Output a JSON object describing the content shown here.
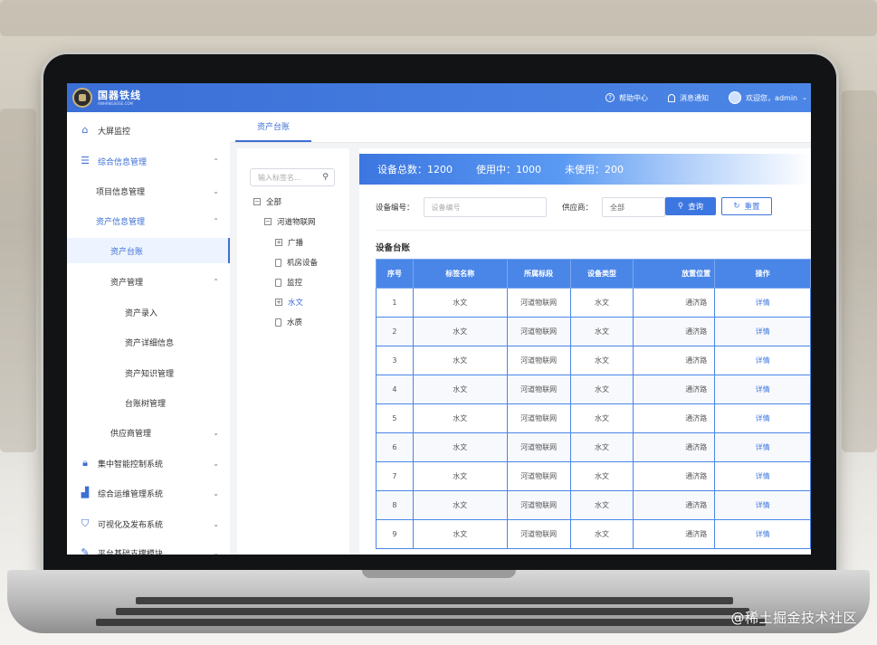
{
  "app": {
    "logo_title": "国器铁线",
    "logo_subtitle": "ANHANGSOSE.COM"
  },
  "topbar": {
    "help_label": "帮助中心",
    "notice_label": "消息通知",
    "user_label": "欢迎您，admin"
  },
  "sidebar": {
    "items": [
      {
        "label": "大屏监控",
        "icon": "home-icon"
      },
      {
        "label": "综合信息管理",
        "icon": "list-icon"
      },
      {
        "label": "项目信息管理"
      },
      {
        "label": "资产信息管理"
      },
      {
        "label": "资产台账"
      },
      {
        "label": "资产管理"
      },
      {
        "label": "资产录入"
      },
      {
        "label": "资产详细信息"
      },
      {
        "label": "资产知识管理"
      },
      {
        "label": "台账树管理"
      },
      {
        "label": "供应商管理"
      },
      {
        "label": "集中智能控制系统",
        "icon": "lock-icon"
      },
      {
        "label": "综合运维管理系统",
        "icon": "chart-icon"
      },
      {
        "label": "可视化及发布系统",
        "icon": "shield-icon"
      },
      {
        "label": "平台基础支撑模块",
        "icon": "edit-icon"
      }
    ]
  },
  "tabs": {
    "active": "资产台账"
  },
  "tree": {
    "search_placeholder": "输入标签名...",
    "nodes": [
      "全部",
      "河道物联网",
      "广播",
      "机房设备",
      "监控",
      "水文",
      "水质"
    ]
  },
  "stats": {
    "total": "设备总数：1200",
    "in_use": "使用中：1000",
    "unused": "未使用：200"
  },
  "filter": {
    "code_label": "设备编号：",
    "code_placeholder": "设备编号",
    "supplier_label": "供应商：",
    "supplier_value": "全部",
    "query_label": "查询",
    "reset_label": "重置"
  },
  "table": {
    "title": "设备台账",
    "headers": [
      "序号",
      "标签名称",
      "所属标段",
      "设备类型",
      "放置位置",
      "操作"
    ],
    "rows": [
      [
        "1",
        "水文",
        "河道物联网",
        "水文",
        "通济路",
        "详情"
      ],
      [
        "2",
        "水文",
        "河道物联网",
        "水文",
        "通济路",
        "详情"
      ],
      [
        "3",
        "水文",
        "河道物联网",
        "水文",
        "通济路",
        "详情"
      ],
      [
        "4",
        "水文",
        "河道物联网",
        "水文",
        "通济路",
        "详情"
      ],
      [
        "5",
        "水文",
        "河道物联网",
        "水文",
        "通济路",
        "详情"
      ],
      [
        "6",
        "水文",
        "河道物联网",
        "水文",
        "通济路",
        "详情"
      ],
      [
        "7",
        "水文",
        "河道物联网",
        "水文",
        "通济路",
        "详情"
      ],
      [
        "8",
        "水文",
        "河道物联网",
        "水文",
        "通济路",
        "详情"
      ],
      [
        "9",
        "水文",
        "河道物联网",
        "水文",
        "通济路",
        "详情"
      ]
    ]
  },
  "watermark": "@稀土掘金技术社区",
  "colors": {
    "primary": "#3c76e0",
    "topbar": "#4b86e6"
  }
}
